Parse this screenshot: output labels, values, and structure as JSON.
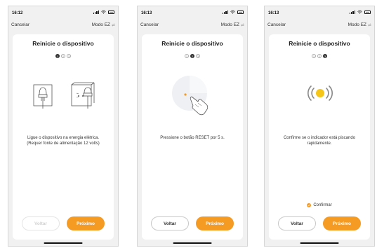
{
  "screens": [
    {
      "time": "16:12",
      "cancel": "Cancelar",
      "mode": "Modo EZ",
      "title": "Reinicie o dispositivo",
      "steps": [
        "1",
        "2",
        "3"
      ],
      "active_step": 1,
      "instruction_line1": "Ligue o dispositivo na energia elétrica.",
      "instruction_line2": "(Requer fonte de alimentação 12 volts)",
      "back_label": "Voltar",
      "next_label": "Próximo",
      "back_disabled": true,
      "illustration": "plug-sockets-icon"
    },
    {
      "time": "16:13",
      "cancel": "Cancelar",
      "mode": "Modo EZ",
      "title": "Reinicie o dispositivo",
      "steps": [
        "1",
        "2",
        "3"
      ],
      "active_step": 2,
      "instruction_line1": "Pressione o botão RESET por 5 s.",
      "back_label": "Voltar",
      "next_label": "Próximo",
      "back_disabled": false,
      "illustration": "reset-button-press-icon"
    },
    {
      "time": "16:13",
      "cancel": "Cancelar",
      "mode": "Modo EZ",
      "title": "Reinicie o dispositivo",
      "steps": [
        "1",
        "2",
        "3"
      ],
      "active_step": 3,
      "instruction_line1": "Confirme se o indicador está piscando",
      "instruction_line2": "rapidamente.",
      "confirm_label": "Confirmar",
      "back_label": "Voltar",
      "next_label": "Próximo",
      "back_disabled": false,
      "illustration": "blinking-indicator-icon"
    }
  ],
  "colors": {
    "accent": "#f59a23",
    "background": "#f1f1f1",
    "card": "#ffffff",
    "battery": "#28b74a"
  }
}
